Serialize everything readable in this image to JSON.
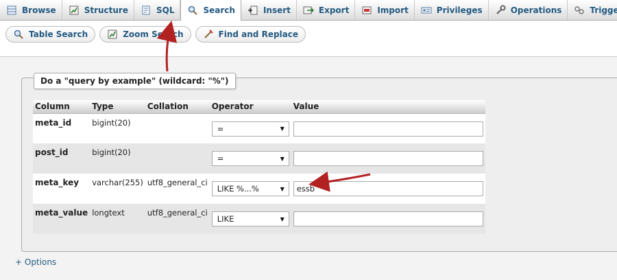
{
  "top_tabs": [
    {
      "label": "Browse",
      "icon": "browse-icon"
    },
    {
      "label": "Structure",
      "icon": "structure-icon"
    },
    {
      "label": "SQL",
      "icon": "sql-icon"
    },
    {
      "label": "Search",
      "icon": "search-icon",
      "active": true
    },
    {
      "label": "Insert",
      "icon": "insert-icon"
    },
    {
      "label": "Export",
      "icon": "export-icon"
    },
    {
      "label": "Import",
      "icon": "import-icon"
    },
    {
      "label": "Privileges",
      "icon": "privileges-icon"
    },
    {
      "label": "Operations",
      "icon": "operations-icon"
    },
    {
      "label": "Triggers",
      "icon": "triggers-icon"
    }
  ],
  "sub_tabs": [
    {
      "label": "Table Search",
      "icon": "search-icon"
    },
    {
      "label": "Zoom Search",
      "icon": "zoom-search-icon"
    },
    {
      "label": "Find and Replace",
      "icon": "find-replace-icon"
    }
  ],
  "query": {
    "legend": "Do a \"query by example\" (wildcard: \"%\")",
    "headers": {
      "column": "Column",
      "type": "Type",
      "collation": "Collation",
      "operator": "Operator",
      "value": "Value"
    },
    "rows": [
      {
        "column": "meta_id",
        "type": "bigint(20)",
        "collation": "",
        "operator": "=",
        "value": ""
      },
      {
        "column": "post_id",
        "type": "bigint(20)",
        "collation": "",
        "operator": "=",
        "value": ""
      },
      {
        "column": "meta_key",
        "type": "varchar(255)",
        "collation": "utf8_general_ci",
        "operator": "LIKE %...%",
        "value": "essb"
      },
      {
        "column": "meta_value",
        "type": "longtext",
        "collation": "utf8_general_ci",
        "operator": "LIKE",
        "value": ""
      }
    ]
  },
  "options_link": "+ Options",
  "colors": {
    "link": "#235a81",
    "annotation_arrow": "#b22222"
  }
}
